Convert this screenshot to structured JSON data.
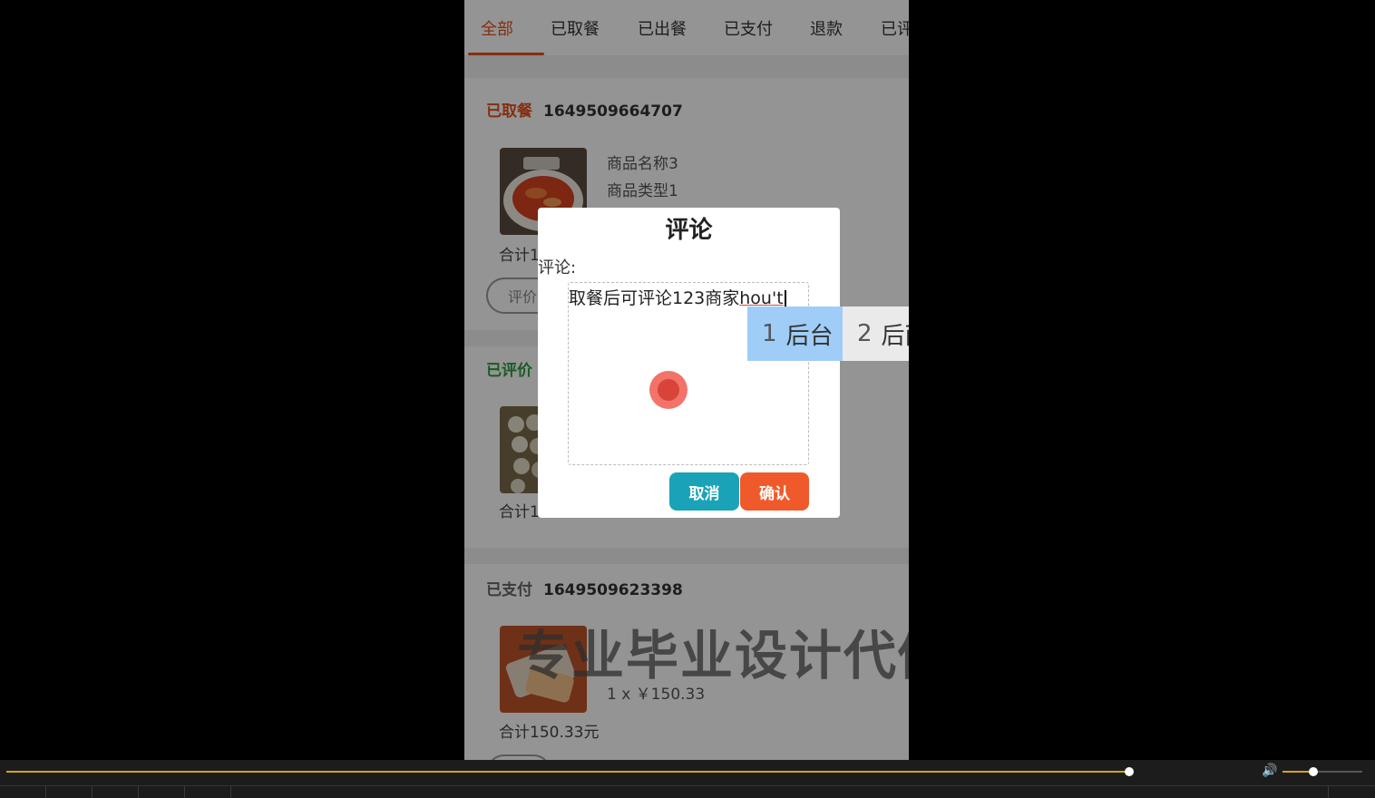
{
  "tabs": [
    "全部",
    "已取餐",
    "已出餐",
    "已支付",
    "退款",
    "已评"
  ],
  "orders": [
    {
      "status": "已取餐",
      "order_no": "1649509664707",
      "name": "商品名称3",
      "type": "商品类型1",
      "total": "合计1",
      "action": "评价"
    },
    {
      "status": "已评价",
      "total": "合计1"
    },
    {
      "status": "已支付",
      "order_no": "1649509623398",
      "price_line": "1 x ￥150.33",
      "total": "合计150.33元"
    }
  ],
  "watermark": "专业毕业设计代做",
  "dialog": {
    "title": "评论",
    "label": "评论:",
    "comment_value": "取餐后可评论123商家",
    "ime_composition": "hou't",
    "cancel_label": "取消",
    "confirm_label": "确认"
  },
  "ime": {
    "candidates": [
      {
        "num": "1",
        "text": "后台"
      },
      {
        "num": "2",
        "text": "后面"
      }
    ]
  },
  "player": {
    "progress": 0.906,
    "volume": 0.39
  },
  "colors": {
    "accent": "#e2521e",
    "cancel": "#1aa3b8",
    "confirm": "#f05a2a",
    "progress": "#d7a50f"
  }
}
